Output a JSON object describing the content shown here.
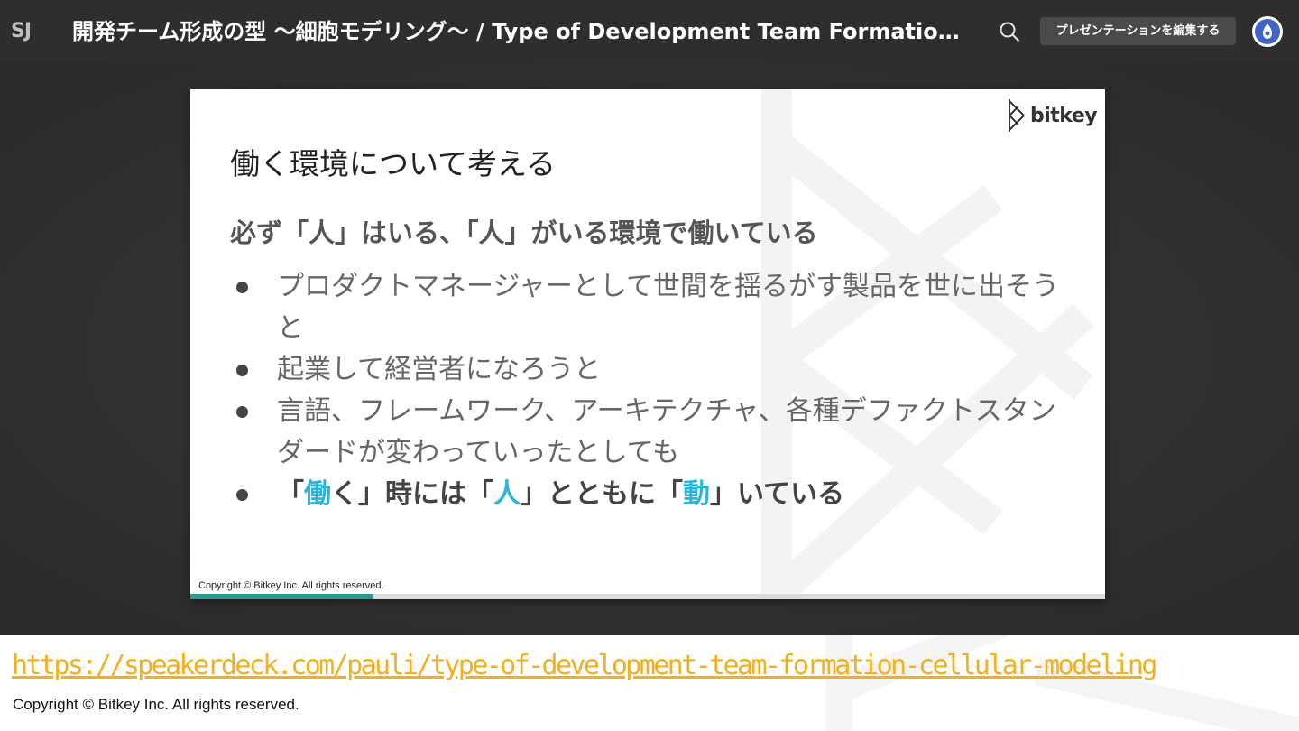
{
  "topbar": {
    "logo_text": "SJ",
    "deck_title": "開発チーム形成の型 〜細胞モデリング〜 / Type of Development Team Formation - …",
    "search_icon": "search-icon",
    "edit_button_label": "プレゼンテーションを編集する",
    "avatar_icon": "user-avatar-icon"
  },
  "slide": {
    "brand": "bitkey",
    "title": "働く環境について考える",
    "subtitle": "必ず「人」はいる、「人」がいる環境で働いている",
    "bullets": [
      "プロダクトマネージャーとして世間を揺るがす製品を世に出そうと",
      "起業して経営者になろうと",
      "言語、フレームワーク、アーキテクチャ、各種デファクトスタンダードが変わっていったとしても"
    ],
    "key_bullet": {
      "p1": "「",
      "h1": "働",
      "p2": "く」時には「",
      "h2": "人",
      "p3": "」とともに「",
      "h3": "動",
      "p4": "」いている"
    },
    "copyright": "Copyright © Bitkey Inc. All rights reserved.",
    "progress_fraction": 0.2,
    "accent_color": "#29b6dd",
    "progress_color": "#2a9d8f"
  },
  "footer": {
    "url": "https://speakerdeck.com/pauli/type-of-development-team-formation-cellular-modeling",
    "copyright": "Copyright © Bitkey Inc. All rights reserved.",
    "link_color": "#f2b01e"
  }
}
